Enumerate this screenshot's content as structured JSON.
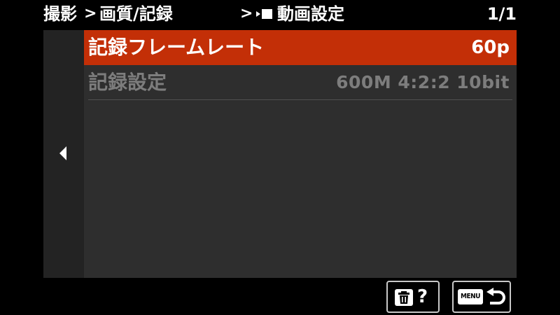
{
  "header": {
    "breadcrumb": [
      "撮影",
      "画質/記録",
      "動画設定"
    ],
    "separator": ">",
    "page_indicator": "1/1"
  },
  "menu": {
    "items": [
      {
        "label": "記録フレームレート",
        "value": "60p",
        "state": "selected"
      },
      {
        "label": "記録設定",
        "value": "600M 4:2:2 10bit",
        "state": "disabled"
      }
    ]
  },
  "footer": {
    "help_label": "?",
    "menu_key_label": "MENU"
  },
  "icons": {
    "movie": "movie-mode-icon",
    "back": "triangle-left-icon",
    "trash": "trash-icon",
    "return": "return-arrow-icon"
  },
  "colors": {
    "highlight": "#c32f07",
    "panel": "#2e2e2e",
    "side_panel": "#232323",
    "disabled_text": "#7d7d7d"
  }
}
